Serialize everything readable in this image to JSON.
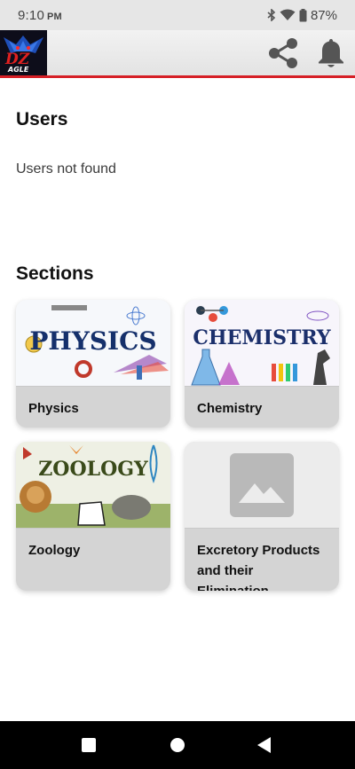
{
  "status_bar": {
    "time": "9:10",
    "ampm": "PM",
    "battery": "87%"
  },
  "app_bar": {
    "logo_text": "DZ EAGLE"
  },
  "users": {
    "title": "Users",
    "empty_message": "Users not found"
  },
  "sections": {
    "title": "Sections",
    "items": [
      {
        "label": "Physics",
        "thumbnail_text": "PHYSICS"
      },
      {
        "label": "Chemistry",
        "thumbnail_text": "CHEMISTRY"
      },
      {
        "label": "Zoology",
        "thumbnail_text": "ZOOLOGY"
      },
      {
        "label": "Excretory Products and their Elimination",
        "thumbnail_text": ""
      }
    ]
  },
  "colors": {
    "accent": "#d61f26",
    "card_bg": "#d4d4d4",
    "icon_grey": "#555555"
  }
}
